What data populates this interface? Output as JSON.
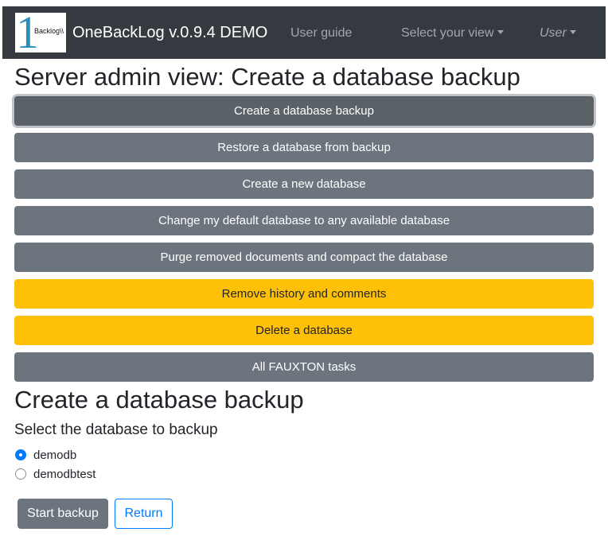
{
  "navbar": {
    "logo_text": "Backlog\\\\",
    "logo_numeral": "1",
    "brand": "OneBackLog v.0.9.4 DEMO",
    "links": {
      "user_guide": "User guide",
      "select_view": "Select your view",
      "user": "User"
    }
  },
  "page": {
    "title": "Server admin view: Create a database backup"
  },
  "actions": [
    {
      "label": "Create a database backup",
      "style": "secondary",
      "active": true
    },
    {
      "label": "Restore a database from backup",
      "style": "secondary"
    },
    {
      "label": "Create a new database",
      "style": "secondary"
    },
    {
      "label": "Change my default database to any available database",
      "style": "secondary"
    },
    {
      "label": "Purge removed documents and compact the database",
      "style": "secondary"
    },
    {
      "label": "Remove history and comments",
      "style": "warning"
    },
    {
      "label": "Delete a database",
      "style": "warning"
    },
    {
      "label": "All FAUXTON tasks",
      "style": "secondary"
    }
  ],
  "backup_form": {
    "title": "Create a database backup",
    "prompt": "Select the database to backup",
    "options": [
      {
        "label": "demodb",
        "checked": true
      },
      {
        "label": "demodbtest",
        "checked": false
      }
    ],
    "start_label": "Start backup",
    "return_label": "Return"
  },
  "colors": {
    "navbar_bg": "#343a40",
    "secondary": "#6c757d",
    "warning": "#ffc107",
    "primary": "#007bff",
    "logo_numeral": "#2d8fb5"
  }
}
